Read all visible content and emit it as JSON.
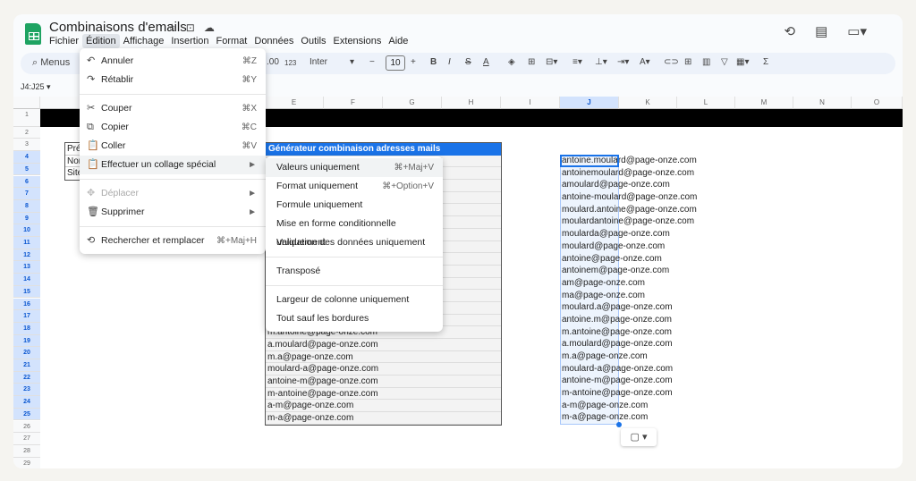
{
  "app": {
    "title": "Combinaisons d'emails",
    "title_icons": [
      "star-icon",
      "folder-move-icon",
      "cloud-icon"
    ],
    "menus": [
      "Fichier",
      "Édition",
      "Affichage",
      "Insertion",
      "Format",
      "Données",
      "Outils",
      "Extensions",
      "Aide"
    ],
    "active_menu": "Édition",
    "right_icons": [
      "history-icon",
      "comment-icon",
      "video-call-icon"
    ]
  },
  "toolbar": {
    "search_label": "Menus",
    "decimal": ".00",
    "format123": "123",
    "font": "Inter",
    "font_size": "10",
    "bold": "B",
    "italic": "I",
    "strike": "S",
    "textcolor": "A",
    "sigma": "Σ"
  },
  "namebox": "J4:J25",
  "columns": [
    "A",
    "",
    "",
    "",
    "E",
    "F",
    "G",
    "H",
    "I",
    "J",
    "K",
    "L",
    "M",
    "N",
    "O"
  ],
  "rows": [
    "1",
    "2",
    "3",
    "4",
    "5",
    "6",
    "7",
    "8",
    "9",
    "10",
    "11",
    "12",
    "13",
    "14",
    "15",
    "16",
    "17",
    "18",
    "19",
    "20",
    "21",
    "22",
    "23",
    "24",
    "25",
    "26",
    "27",
    "28",
    "29"
  ],
  "infobox": [
    "Pré",
    "Nor",
    "Site"
  ],
  "generator": {
    "header": "Générateur combinaison adresses mails",
    "visible_rows": [
      "m.antoine@page-onze.com",
      "a.moulard@page-onze.com",
      "m.a@page-onze.com",
      "moulard-a@page-onze.com",
      "antoine-m@page-onze.com",
      "m-antoine@page-onze.com",
      "a-m@page-onze.com",
      "m-a@page-onze.com"
    ]
  },
  "jcolumn": [
    "antoine.moulard@page-onze.com",
    "antoinemoulard@page-onze.com",
    "amoulard@page-onze.com",
    "antoine-moulard@page-onze.com",
    "moulard.antoine@page-onze.com",
    "moulardantoine@page-onze.com",
    "moularda@page-onze.com",
    "moulard@page-onze.com",
    "antoine@page-onze.com",
    "antoinem@page-onze.com",
    "am@page-onze.com",
    "ma@page-onze.com",
    "moulard.a@page-onze.com",
    "antoine.m@page-onze.com",
    "m.antoine@page-onze.com",
    "a.moulard@page-onze.com",
    "m.a@page-onze.com",
    "moulard-a@page-onze.com",
    "antoine-m@page-onze.com",
    "m-antoine@page-onze.com",
    "a-m@page-onze.com",
    "m-a@page-onze.com"
  ],
  "edit_menu": [
    {
      "label": "Annuler",
      "shortcut": "⌘Z",
      "icon": "↶"
    },
    {
      "label": "Rétablir",
      "shortcut": "⌘Y",
      "icon": "↷"
    },
    {
      "label": "Couper",
      "shortcut": "⌘X",
      "icon": "✂"
    },
    {
      "label": "Copier",
      "shortcut": "⌘C",
      "icon": "⧉"
    },
    {
      "label": "Coller",
      "shortcut": "⌘V",
      "icon": "📋"
    },
    {
      "label": "Effectuer un collage spécial",
      "shortcut": "►",
      "icon": "📋"
    },
    {
      "label": "Déplacer",
      "shortcut": "►",
      "icon": "✥"
    },
    {
      "label": "Supprimer",
      "shortcut": "►",
      "icon": "🗑"
    },
    {
      "label": "Rechercher et remplacer",
      "shortcut": "⌘+Maj+H",
      "icon": "⟲"
    }
  ],
  "paste_special_menu": [
    {
      "label": "Valeurs uniquement",
      "shortcut": "⌘+Maj+V"
    },
    {
      "label": "Format uniquement",
      "shortcut": "⌘+Option+V"
    },
    {
      "label": "Formule uniquement",
      "shortcut": ""
    },
    {
      "label": "Mise en forme conditionnelle uniquement",
      "shortcut": ""
    },
    {
      "label": "Validation des données uniquement",
      "shortcut": ""
    },
    {
      "label": "Transposé",
      "shortcut": ""
    },
    {
      "label": "Largeur de colonne uniquement",
      "shortcut": ""
    },
    {
      "label": "Tout sauf les bordures",
      "shortcut": ""
    }
  ]
}
